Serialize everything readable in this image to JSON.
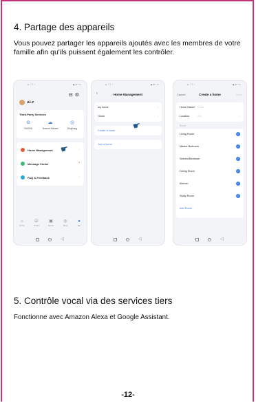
{
  "section4": {
    "heading": "4. Partage des appareils",
    "body": "Vous pouvez partager les appareils ajoutés avec les membres de votre famille afin qu'ils puissent également les contrôler."
  },
  "section5": {
    "heading": "5. Contrôle vocal via des services tiers",
    "body": "Fonctionne avec Amazon Alexa et Google Assistant."
  },
  "page_number": "-12-",
  "phone1": {
    "user_name": "Hii-Z",
    "third_party_title": "Third-Party Services",
    "services": [
      {
        "label": "XIAODU",
        "icon": "xiaodu-icon"
      },
      {
        "label": "Tencent Xiaowei",
        "icon": "cloud-icon"
      },
      {
        "label": "DingDong",
        "icon": "dingdong-icon"
      }
    ],
    "menu": [
      {
        "label": "Home Management",
        "color": "#e8593c"
      },
      {
        "label": "Message Center",
        "color": "#3bb87a"
      },
      {
        "label": "FAQ & Feedback",
        "color": "#2ba8d8"
      }
    ],
    "tabs": [
      "Home",
      "Smart",
      "Scene",
      "Shop",
      "Me"
    ]
  },
  "phone2": {
    "title": "Home Management",
    "homes": [
      "my home",
      "Home"
    ],
    "create_home": "Create a home",
    "join_home": "Join a home"
  },
  "phone3": {
    "cancel": "Cancel",
    "title": "Create a home",
    "save": "Save",
    "home_name_label": "Home Name*",
    "home_name_placeholder": "Enter",
    "location_label": "Location",
    "location_value": "Set",
    "rooms_label": "Room:",
    "rooms": [
      "Living Room",
      "Master Bedroom",
      "Second Bedroom",
      "Dining Room",
      "Kitchen",
      "Study Room"
    ],
    "add_room": "Add Room"
  },
  "accent_color": "#c4307a",
  "link_color": "#3a7be0"
}
